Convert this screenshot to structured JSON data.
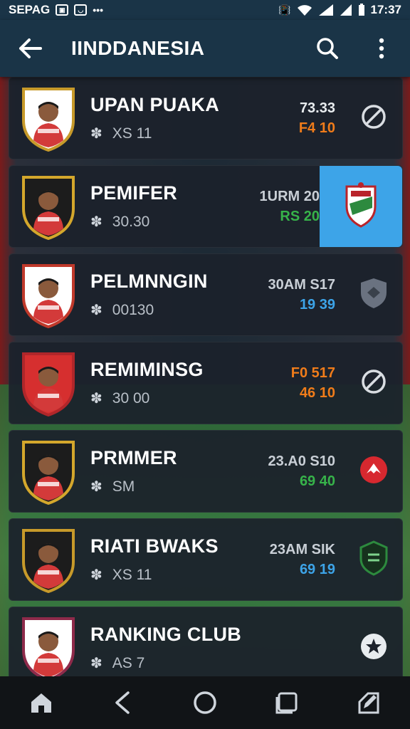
{
  "status_bar": {
    "carrier": "SEPAG",
    "time": "17:37"
  },
  "app_bar": {
    "title": "IINDDANESIA"
  },
  "cards": [
    {
      "name": "UPAN PUAKA",
      "sub": "XS 11",
      "stat1": "73.33",
      "stat2": "F4 10",
      "stat1_color": "#e8ecef",
      "stat2_color": "#f07c1a",
      "action_icon": "no-entry-icon",
      "badge_color": "#ffffff",
      "badge_border": "#c79a2a"
    },
    {
      "name": "PEMIFER",
      "sub": "30.30",
      "stat1": "1URM 20",
      "stat2": "RS 20",
      "stat1_color": "#c9cfd6",
      "stat2_color": "#37b34a",
      "action_icon": "club-crest-icon",
      "badge_color": "#1c1c1c",
      "badge_border": "#d4a72c"
    },
    {
      "name": "PELMNNGIN",
      "sub": "00130",
      "stat1": "30AM S17",
      "stat2": "19 39",
      "stat1_color": "#c9cfd6",
      "stat2_color": "#3da4e8",
      "action_icon": "shield-icon",
      "badge_color": "#ffffff",
      "badge_border": "#c0392b"
    },
    {
      "name": "REMIMINSG",
      "sub": "30 00",
      "stat1": "F0 517",
      "stat2": "46 10",
      "stat1_color": "#f07c1a",
      "stat2_color": "#f07c1a",
      "action_icon": "no-entry-icon",
      "badge_color": "#d62f2f",
      "badge_border": "#b0262a"
    },
    {
      "name": "PRMMER",
      "sub": "SM",
      "stat1": "23.A0 S10",
      "stat2": "69 40",
      "stat1_color": "#c9cfd6",
      "stat2_color": "#37b34a",
      "action_icon": "alert-icon",
      "badge_color": "#1c1c1c",
      "badge_border": "#d4a72c"
    },
    {
      "name": "RIATI BWAKS",
      "sub": "XS 11",
      "stat1": "23AM SIK",
      "stat2": "69 19",
      "stat1_color": "#c9cfd6",
      "stat2_color": "#3da4e8",
      "action_icon": "shield-badge-icon",
      "badge_color": "#1c1c1c",
      "badge_border": "#c79a2a"
    },
    {
      "name": "RANKING CLUB",
      "sub": "AS 7",
      "stat1": "",
      "stat2": "",
      "stat1_color": "#c9cfd6",
      "stat2_color": "#c9cfd6",
      "action_icon": "star-icon",
      "badge_color": "#ffffff",
      "badge_border": "#8e2a4a"
    }
  ],
  "action_colors": {
    "alert": "#d7282f",
    "shield_badge": "#2d8a3e",
    "highlight": "#3da4e8"
  }
}
